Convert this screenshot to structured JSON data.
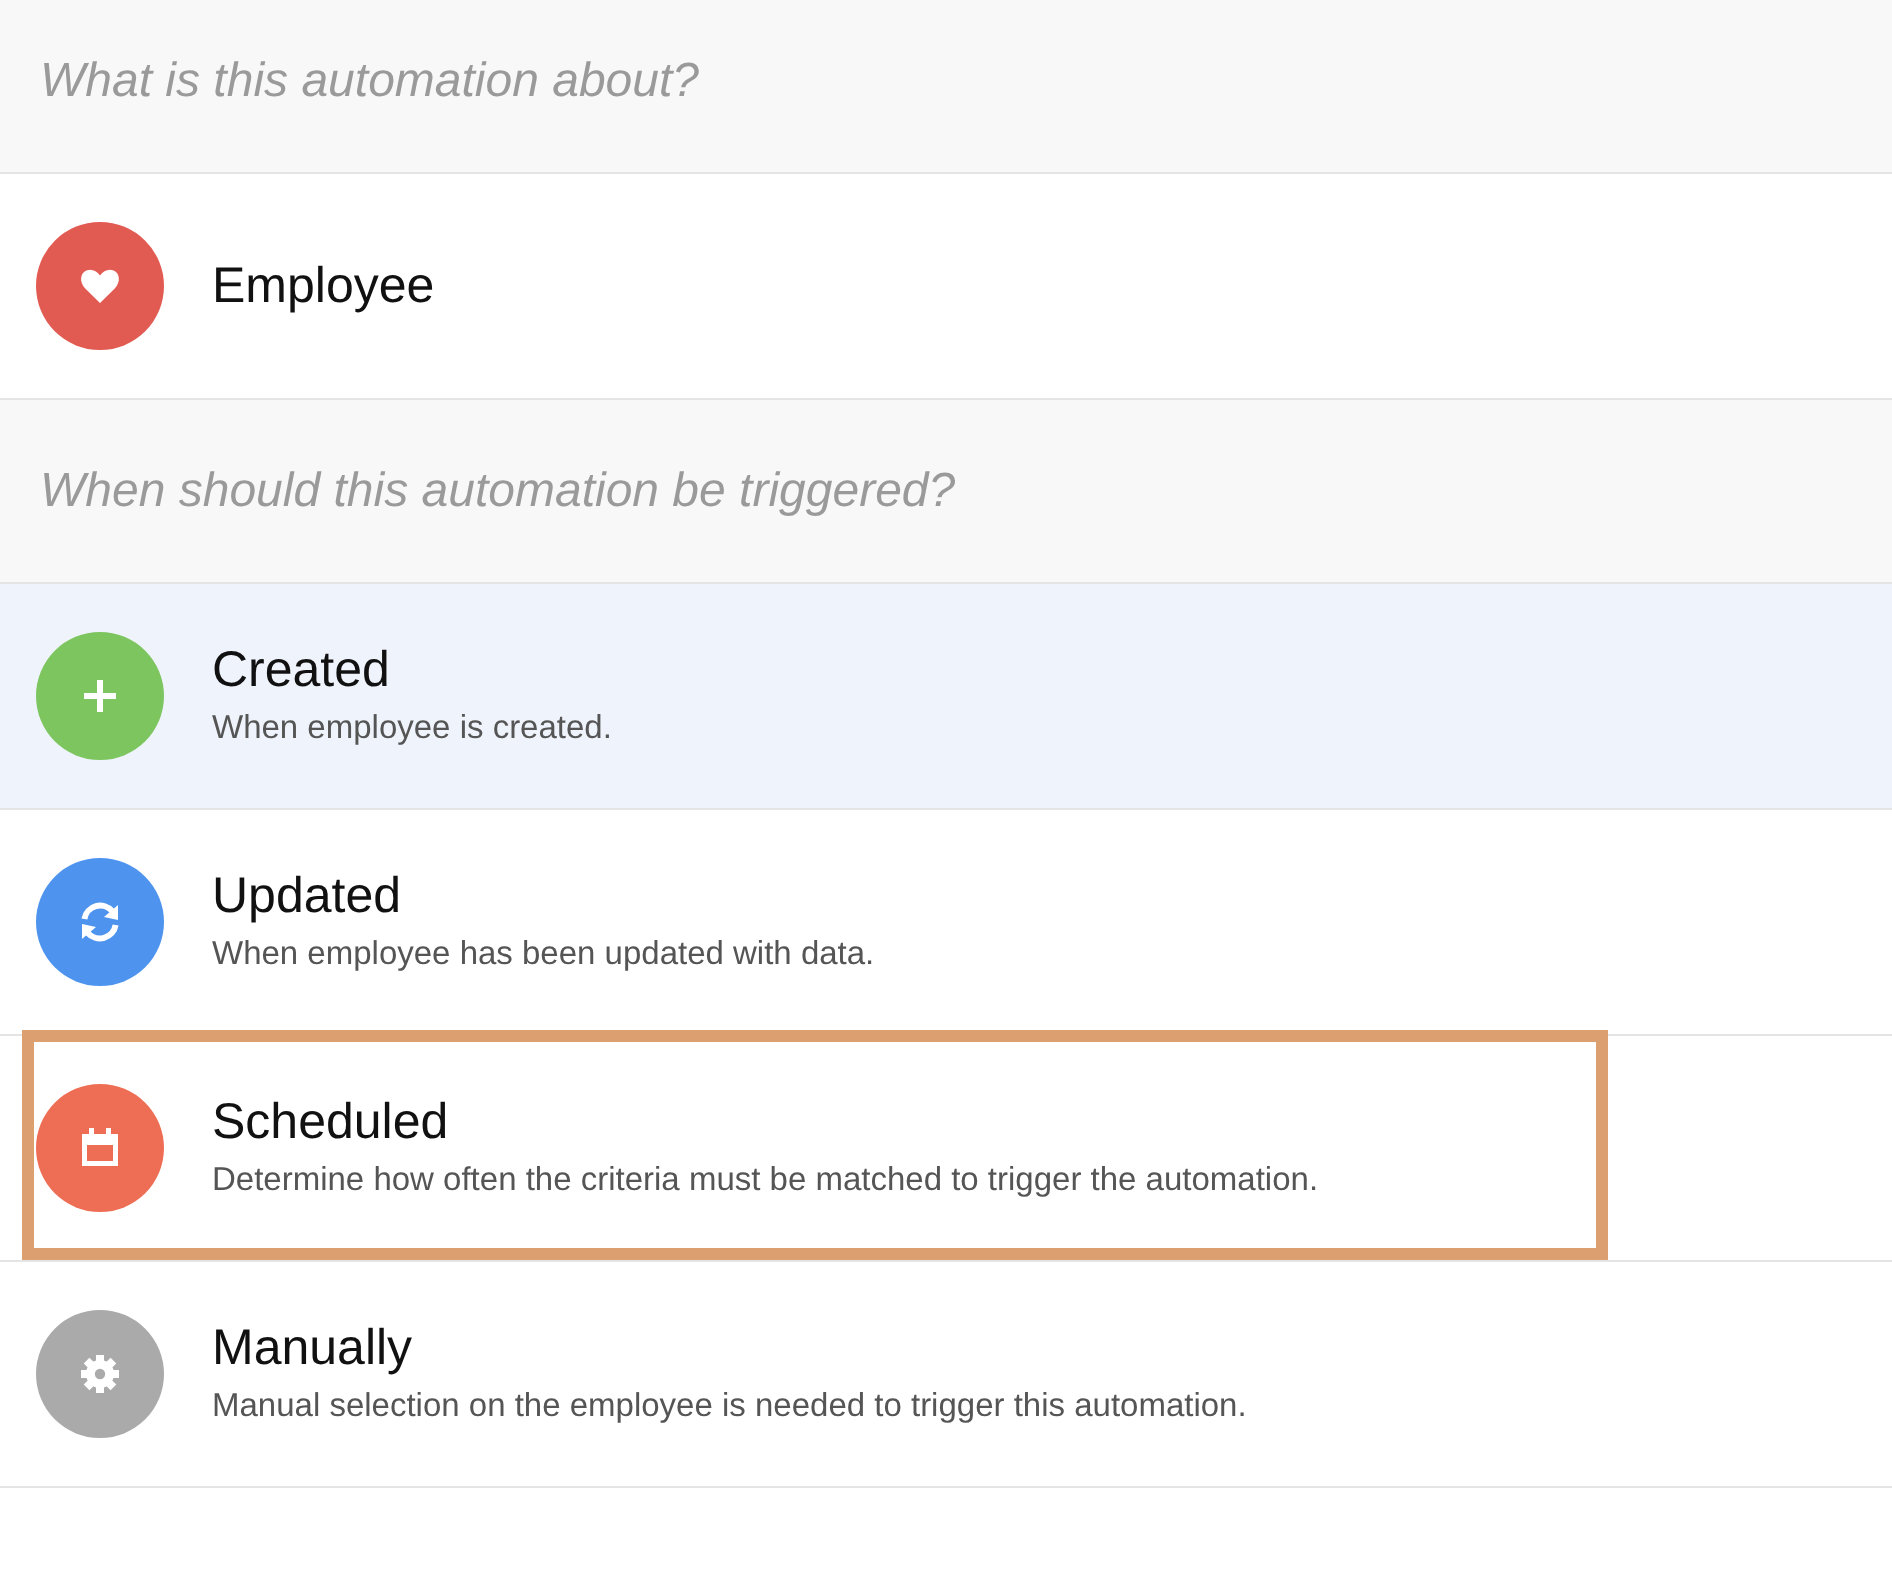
{
  "object_section": {
    "question": "What is this automation about?",
    "object": {
      "label": "Employee"
    }
  },
  "trigger_section": {
    "question": "When should this automation be triggered?",
    "triggers": [
      {
        "kind": "created",
        "title": "Created",
        "description": "When employee is created.",
        "color": "#7dc55f",
        "selected": true,
        "highlighted": false
      },
      {
        "kind": "updated",
        "title": "Updated",
        "description": "When employee has been updated with data.",
        "color": "#4e94ef",
        "selected": false,
        "highlighted": false
      },
      {
        "kind": "scheduled",
        "title": "Scheduled",
        "description": "Determine how often the criteria must be matched to trigger the automation.",
        "color": "#ee6e55",
        "selected": false,
        "highlighted": true
      },
      {
        "kind": "manual",
        "title": "Manually",
        "description": "Manual selection on the employee is needed to trigger this automation.",
        "color": "#aaaaaa",
        "selected": false,
        "highlighted": false
      }
    ]
  }
}
